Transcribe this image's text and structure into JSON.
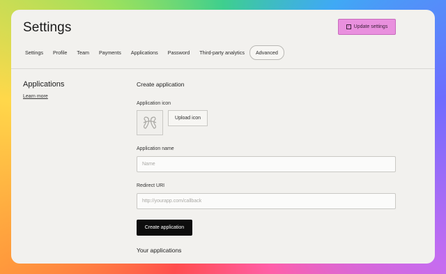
{
  "header": {
    "title": "Settings",
    "update_button": "Update settings"
  },
  "tabs": [
    {
      "label": "Settings"
    },
    {
      "label": "Profile"
    },
    {
      "label": "Team"
    },
    {
      "label": "Payments"
    },
    {
      "label": "Applications"
    },
    {
      "label": "Password"
    },
    {
      "label": "Third-party analytics"
    },
    {
      "label": "Advanced",
      "active": true
    }
  ],
  "sidebar": {
    "title": "Applications",
    "learn_more": "Learn more"
  },
  "form": {
    "heading": "Create application",
    "icon_label": "Application icon",
    "upload_button": "Upload icon",
    "name_label": "Application name",
    "name_placeholder": "Name",
    "redirect_label": "Redirect URI",
    "redirect_placeholder": "http://yourapp.com/callback",
    "create_button": "Create application",
    "your_apps_heading": "Your applications"
  },
  "colors": {
    "accent_button": "#e990de",
    "primary_button": "#0d0d0d",
    "card_background": "#f2f1ee"
  }
}
